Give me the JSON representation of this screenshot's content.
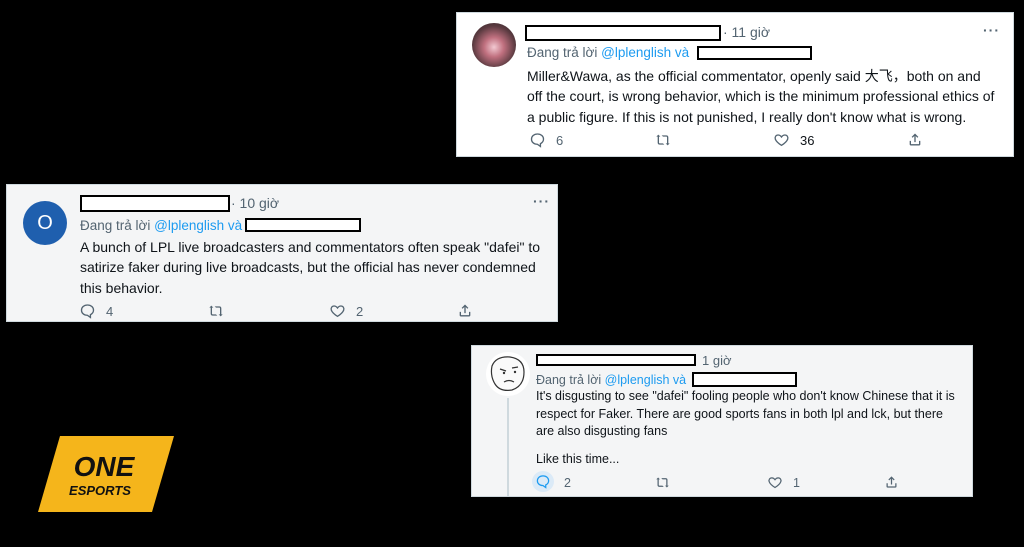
{
  "tweets": {
    "t1": {
      "time": "· 11 giờ",
      "reply_prefix": "Đang trả lời ",
      "reply_handle": "@lplenglish và",
      "text": "Miller&Wawa, as the official commentator, openly said 大飞，both on and off the court, is wrong behavior, which is the minimum professional ethics of a public figure. If this is not punished, I really don't know what is wrong.",
      "replies": "6",
      "retweets": "",
      "likes": "36",
      "more": "···"
    },
    "t2": {
      "avatar_letter": "O",
      "time": "· 10 giờ",
      "reply_prefix": "Đang trả lời ",
      "reply_handle": "@lplenglish và",
      "text": "A bunch of LPL live broadcasters and commentators often speak \"dafei\" to satirize faker during live broadcasts, but the official has never condemned this behavior.",
      "replies": "4",
      "retweets": "",
      "likes": "2",
      "more": "···"
    },
    "t3": {
      "time": "1 giờ",
      "reply_prefix": "Đang trả lời ",
      "reply_handle": "@lplenglish và",
      "text": "It's disgusting to see \"dafei\" fooling people who don't know Chinese that it is respect for Faker. There are good sports fans in both lpl and lck, but there are also disgusting fans",
      "text2": "Like this time...",
      "replies": "2",
      "retweets": "",
      "likes": "1",
      "more": "···"
    }
  },
  "logo": {
    "line1": "ONE",
    "line2": "ESPORTS",
    "color": "#f5b51b"
  },
  "colors": {
    "link": "#1d9bf0",
    "muted": "#536471"
  }
}
